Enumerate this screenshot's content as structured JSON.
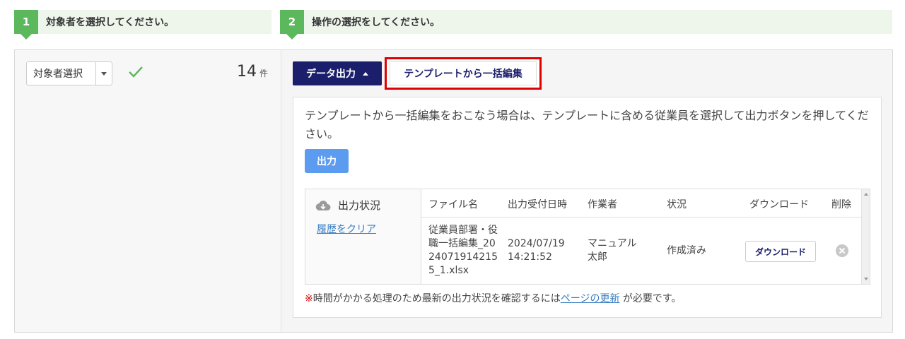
{
  "steps": [
    {
      "number": "1",
      "label": "対象者を選択してください。"
    },
    {
      "number": "2",
      "label": "操作の選択をしてください。"
    }
  ],
  "target": {
    "select_label": "対象者選択",
    "count": "14",
    "count_unit": "件",
    "check_color": "#5cb85c"
  },
  "actions": {
    "data_output_label": "データ出力",
    "template_edit_label": "テンプレートから一括編集",
    "highlight_color": "#e00000"
  },
  "panel": {
    "description": "テンプレートから一括編集をおこなう場合は、テンプレートに含める従業員を選択して出力ボタンを押してください。",
    "output_button": "出力",
    "status": {
      "title": "出力状況",
      "clear_link": "履歴をクリア",
      "columns": [
        "ファイル名",
        "出力受付日時",
        "作業者",
        "状況",
        "ダウンロード",
        "削除"
      ],
      "rows": [
        {
          "file_name": "従業員部署・役職一括編集_20240719142155_1.xlsx",
          "date": "2024/07/19",
          "time": "14:21:52",
          "worker": "マニュアル太郎",
          "state": "作成済み",
          "download_label": "ダウンロード"
        }
      ]
    },
    "note": {
      "mark": "※",
      "text_before": "時間がかかる処理のため最新の出力状況を確認するには",
      "link": "ページの更新",
      "text_after": " が必要です。"
    }
  }
}
